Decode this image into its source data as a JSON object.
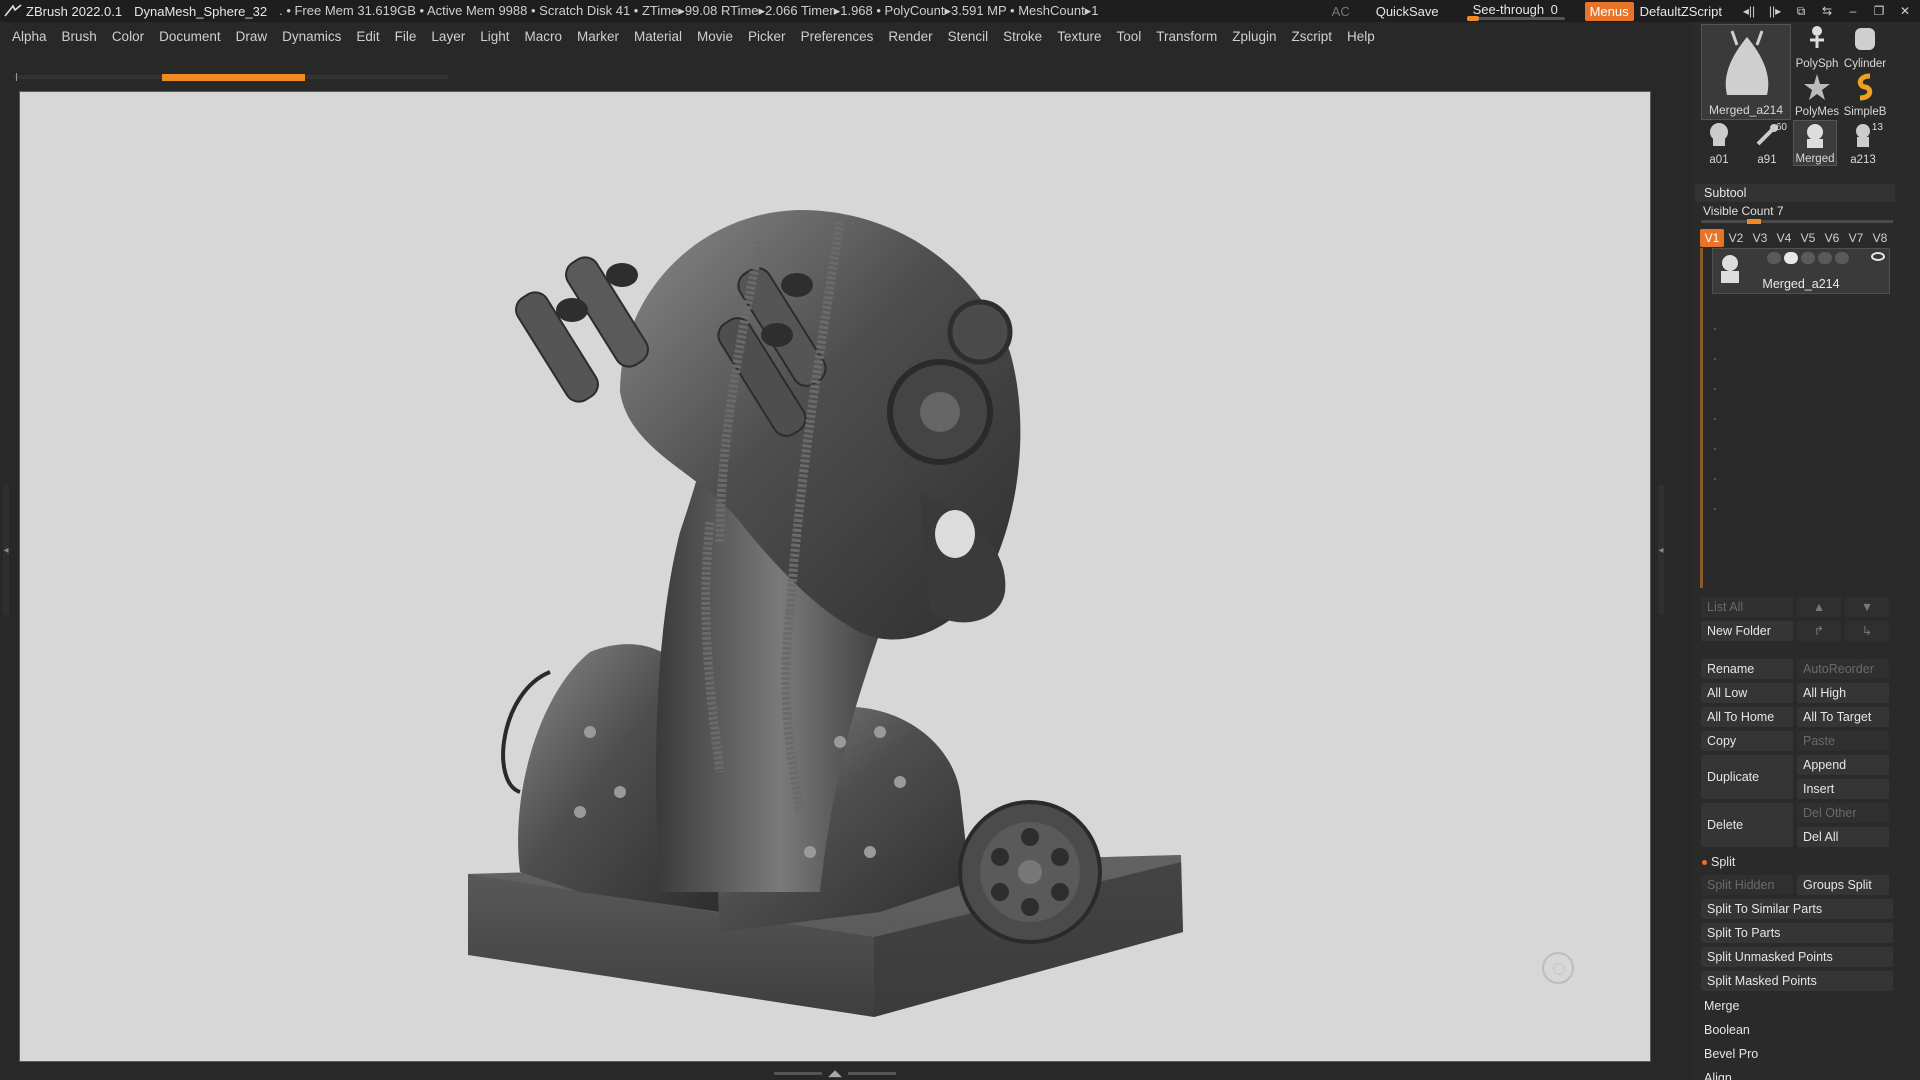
{
  "titlebar": {
    "app": "ZBrush 2022.0.1",
    "document": "DynaMesh_Sphere_32",
    "stats": ". • Free Mem 31.619GB • Active Mem 9988 • Scratch Disk 41 • ZTime▸99.08 RTime▸2.066 Timer▸1.968 • PolyCount▸3.591 MP • MeshCount▸1",
    "ac": "AC",
    "quicksave": "QuickSave",
    "seethrough_label": "See-through",
    "seethrough_value": "0",
    "menus": "Menus",
    "script": "DefaultZScript"
  },
  "menubar": [
    "Alpha",
    "Brush",
    "Color",
    "Document",
    "Draw",
    "Dynamics",
    "Edit",
    "File",
    "Layer",
    "Light",
    "Macro",
    "Marker",
    "Material",
    "Movie",
    "Picker",
    "Preferences",
    "Render",
    "Stencil",
    "Stroke",
    "Texture",
    "Tool",
    "Transform",
    "Zplugin",
    "Zscript",
    "Help"
  ],
  "tools": {
    "current": "Merged_a214",
    "thumbs": [
      {
        "label": "PolySph"
      },
      {
        "label": "Cylinder"
      },
      {
        "label": "PolyMes"
      },
      {
        "label": "SimpleB"
      },
      {
        "label": "a01"
      },
      {
        "label": "a91",
        "count": "60"
      },
      {
        "label": "Merged"
      },
      {
        "label": "a213",
        "count": "13"
      }
    ]
  },
  "subtool": {
    "title": "Subtool",
    "visible_count_label": "Visible Count 7",
    "vtabs": [
      "V1",
      "V2",
      "V3",
      "V4",
      "V5",
      "V6",
      "V7",
      "V8"
    ],
    "active_vtab": "V1",
    "item_name": "Merged_a214"
  },
  "buttons": {
    "list_all": "List All",
    "new_folder": "New Folder",
    "rename": "Rename",
    "autoreorder": "AutoReorder",
    "all_low": "All Low",
    "all_high": "All High",
    "all_to_home": "All To Home",
    "all_to_target": "All To Target",
    "copy": "Copy",
    "paste": "Paste",
    "duplicate": "Duplicate",
    "append": "Append",
    "insert": "Insert",
    "delete": "Delete",
    "del_other": "Del Other",
    "del_all": "Del All",
    "split": "Split",
    "split_hidden": "Split Hidden",
    "groups_split": "Groups Split",
    "split_similar": "Split To Similar Parts",
    "split_parts": "Split To Parts",
    "split_unmasked": "Split Unmasked Points",
    "split_masked": "Split Masked Points",
    "merge": "Merge",
    "boolean": "Boolean",
    "bevel_pro": "Bevel Pro",
    "align": "Align"
  },
  "colors": {
    "accent": "#e8742a",
    "panel": "#2a2a2a",
    "canvas": "#d7d7d7"
  }
}
